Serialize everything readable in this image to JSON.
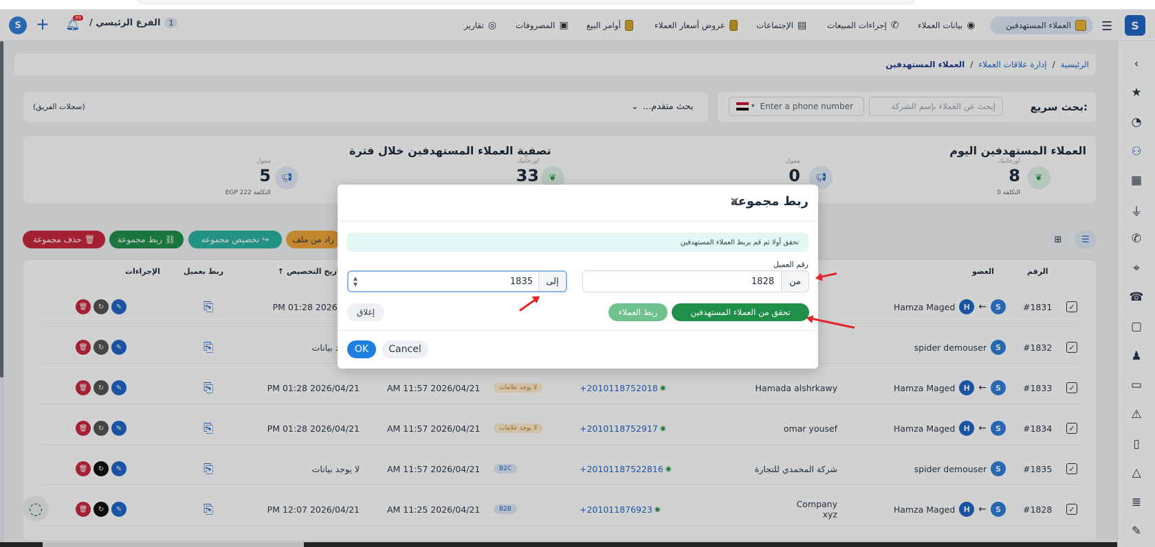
{
  "nav": {
    "branch_count": "1",
    "branch_label": "الفرع الرئيسي /",
    "notif_count": "99",
    "items": [
      {
        "label": "العملاء المستهدفين"
      },
      {
        "label": "بيانات العملاء"
      },
      {
        "label": "إجراءات المبيعات"
      },
      {
        "label": "الإجتماعات"
      },
      {
        "label": "عروض أسعار العملاء"
      },
      {
        "label": "أوامر البيع"
      },
      {
        "label": "المصروفات"
      },
      {
        "label": "تقارير"
      }
    ]
  },
  "breadcrumb": {
    "home": "الرئيسية",
    "section": "إدارة علاقات العملاء",
    "current": "العملاء المستهدفين",
    "sep": "/"
  },
  "search": {
    "quick_label": "بحث سريع:",
    "company_placeholder": "إبحث عن العملاء بإسم الشركة",
    "phone_placeholder": "Enter a phone number",
    "advanced_label": "بحث متقدم...",
    "team_records": "(سجلات الفريق)"
  },
  "stats": {
    "today_title": "العملاء المستهدفين اليوم",
    "period_title": "تصفية العملاء المستهدفين خلال فترة",
    "today_organic_label": "اورجانيك",
    "today_organic_value": "8",
    "today_organic_cost": "التكلفة 0",
    "today_paid_label": "ممول",
    "today_paid_value": "0",
    "period_organic_label": "اورجانيك",
    "period_organic_value": "33",
    "period_paid_label": "ممول",
    "period_paid_value": "5",
    "period_paid_cost": "EGP 222 التكلفة"
  },
  "toolbar": {
    "delete_group": "حذف مجموعة",
    "link_group": "ربط مجموعة",
    "assign_group": "تخصيص مجموعه",
    "import_file": "راد من ملف"
  },
  "table": {
    "headers": {
      "number": "الرقم",
      "member": "العضو",
      "assign_date": "تاريخ التخصيص",
      "link_client": "ربط بعميل",
      "actions": "الإجراءات"
    },
    "rows": [
      {
        "id": "#1831",
        "member": "Hamza Maged",
        "has_h": true,
        "name": "",
        "phone": "",
        "tag": "",
        "created": "",
        "assigned": "PM 01:28 2026/04/2"
      },
      {
        "id": "#1832",
        "member": "spider demouser",
        "has_h": false,
        "name": "",
        "phone": "",
        "tag": "",
        "created": "",
        "assigned": "لا يوجد بيانات"
      },
      {
        "id": "#1833",
        "member": "Hamza Maged",
        "has_h": true,
        "name": "Hamada alshrkawy",
        "phone": "+2010118752018",
        "tag": "لا يوجد علامات",
        "created": "AM 11:57 2026/04/21",
        "assigned": "PM 01:28 2026/04/21"
      },
      {
        "id": "#1834",
        "member": "Hamza Maged",
        "has_h": true,
        "name": "omar yousef",
        "phone": "+2010118752917",
        "tag": "لا يوجد علامات",
        "created": "AM 11:57 2026/04/21",
        "assigned": "PM 01:28 2026/04/21"
      },
      {
        "id": "#1835",
        "member": "spider demouser",
        "has_h": false,
        "name": "شركة المحمدي للتجارة",
        "phone": "+20101187522816",
        "tag": "B2C",
        "created": "AM 11:57 2026/04/21",
        "assigned": "لا يوجد بيانات"
      },
      {
        "id": "#1828",
        "member": "Hamza Maged",
        "has_h": true,
        "name": "Company",
        "name2": "xyz",
        "phone": "+201011876923",
        "tag": "B2B",
        "created": "AM 11:25 2026/04/21",
        "assigned": "PM 12:07 2026/04/21"
      }
    ]
  },
  "modal": {
    "title": "ربط مجموعة",
    "notice": "تحقق أولا ثم قم بربط العملاء المستهدفين",
    "client_number_label": "رقم العميل",
    "from_label": "من",
    "from_value": "1828",
    "to_label": "إلى",
    "to_value": "1835",
    "verify_button": "تحقق من العملاء المستهدفين",
    "link_button": "ربط العملاء",
    "close_button": "إغلاق",
    "ok_button": "OK",
    "cancel_button": "Cancel"
  },
  "colors": {
    "primary": "#1f66c6",
    "danger": "#c8283f",
    "success": "#1f8f4a",
    "teal": "#2bb3a3",
    "orange": "#f0a53a",
    "arrow": "#e0242b"
  }
}
